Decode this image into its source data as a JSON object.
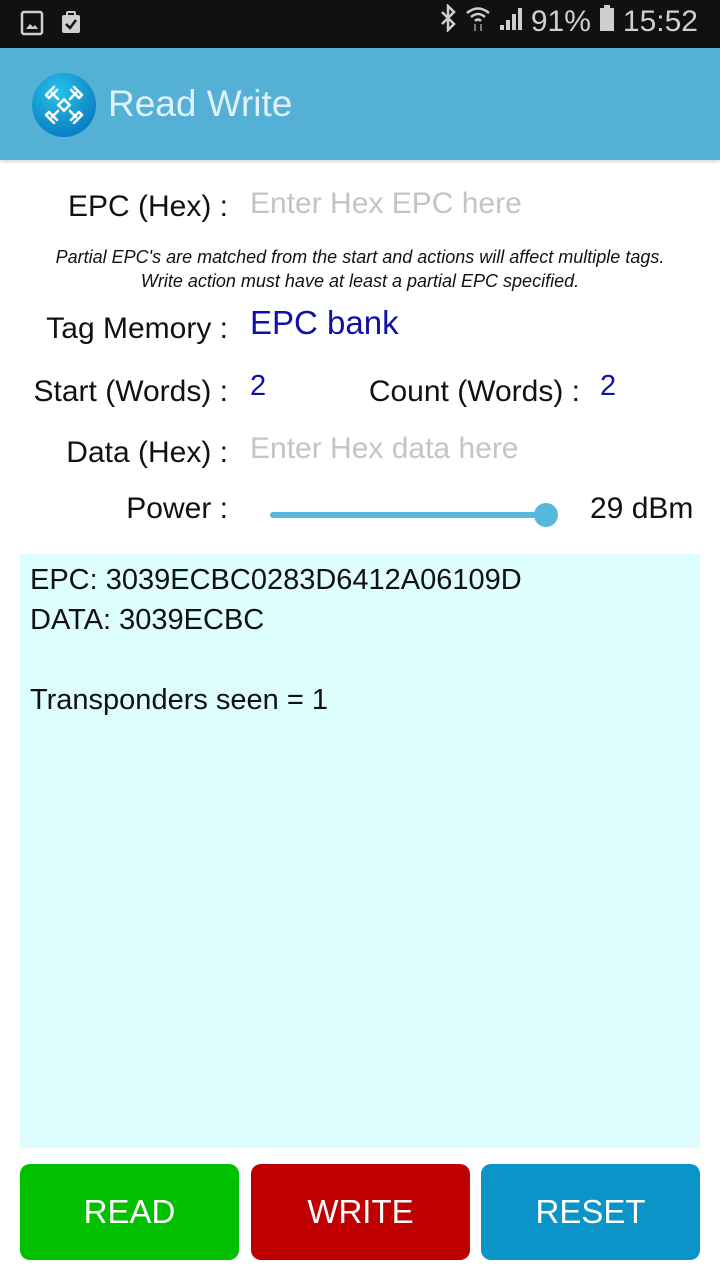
{
  "status_bar": {
    "left_icons": [
      "gallery-icon",
      "clipboard-check-icon"
    ],
    "right_icons": [
      "bluetooth-icon",
      "wifi-icon",
      "signal-icon",
      "battery-icon"
    ],
    "battery": "91%",
    "time": "15:52"
  },
  "app_bar": {
    "title": "Read Write",
    "logo": "rfid-antenna-logo"
  },
  "form": {
    "epc_label": "EPC (Hex) :",
    "epc_placeholder": "Enter Hex EPC here",
    "epc_value": "",
    "note_line1": "Partial EPC's are matched from the start and actions will affect multiple tags.",
    "note_line2": "Write action must have at least a partial EPC specified.",
    "tag_memory_label": "Tag Memory :",
    "tag_memory_value": "EPC bank",
    "start_label": "Start (Words) :",
    "start_value": "2",
    "count_label": "Count (Words) :",
    "count_value": "2",
    "data_label": "Data (Hex) :",
    "data_placeholder": "Enter Hex data here",
    "data_value": "",
    "power_label": "Power :",
    "power_value_text": "29 dBm",
    "power_fraction": 1.0
  },
  "output": {
    "lines": [
      "EPC: 3039ECBC0283D6412A06109D",
      "DATA: 3039ECBC",
      "",
      "Transponders seen = 1"
    ]
  },
  "buttons": {
    "read": {
      "label": "READ",
      "color": "#00c000"
    },
    "write": {
      "label": "WRITE",
      "color": "#c00000"
    },
    "reset": {
      "label": "RESET",
      "color": "#0a94c8"
    }
  }
}
